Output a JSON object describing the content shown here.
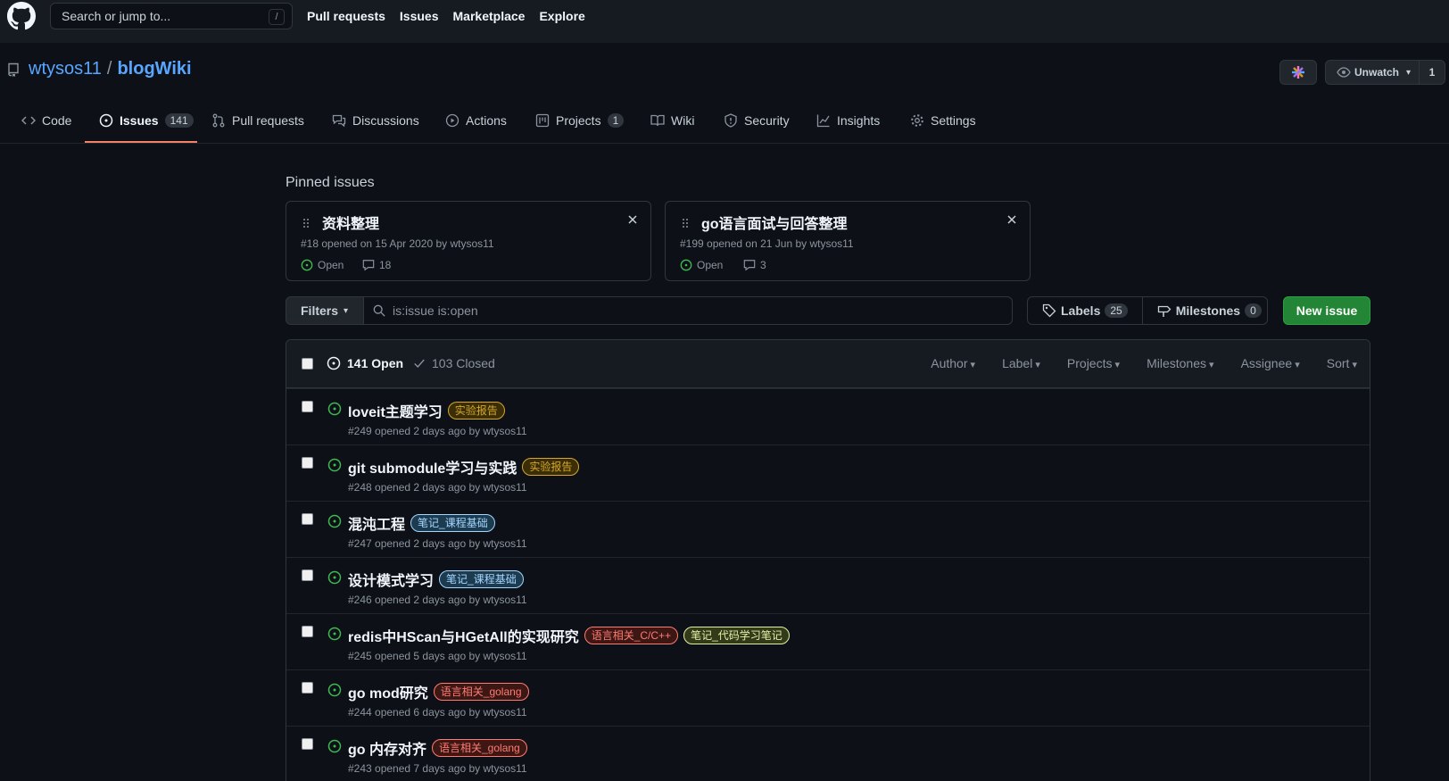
{
  "header": {
    "search_placeholder": "Search or jump to...",
    "search_shortcut": "/",
    "nav": [
      "Pull requests",
      "Issues",
      "Marketplace",
      "Explore"
    ]
  },
  "repo": {
    "owner": "wtysos11",
    "separator": "/",
    "name": "blogWiki",
    "watch_label": "Unwatch",
    "watch_count": "1"
  },
  "tabs": [
    {
      "label": "Code",
      "icon": "code-icon"
    },
    {
      "label": "Issues",
      "count": "141",
      "icon": "issue-icon"
    },
    {
      "label": "Pull requests",
      "icon": "pull-request-icon"
    },
    {
      "label": "Discussions",
      "icon": "discussions-icon"
    },
    {
      "label": "Actions",
      "icon": "play-icon"
    },
    {
      "label": "Projects",
      "count": "1",
      "icon": "project-icon"
    },
    {
      "label": "Wiki",
      "icon": "book-icon"
    },
    {
      "label": "Security",
      "icon": "shield-icon"
    },
    {
      "label": "Insights",
      "icon": "graph-icon"
    },
    {
      "label": "Settings",
      "icon": "gear-icon"
    }
  ],
  "pinned": {
    "title": "Pinned issues",
    "cards": [
      {
        "title": "资料整理",
        "meta": "#18 opened on 15 Apr 2020 by wtysos11",
        "state": "Open",
        "comments": "18"
      },
      {
        "title": "go语言面试与回答整理",
        "meta": "#199 opened on 21 Jun by wtysos11",
        "state": "Open",
        "comments": "3"
      }
    ]
  },
  "filter_bar": {
    "filters_label": "Filters",
    "query": "is:issue is:open",
    "labels_label": "Labels",
    "labels_count": "25",
    "milestones_label": "Milestones",
    "milestones_count": "0",
    "new_issue_label": "New issue"
  },
  "issue_list": {
    "open_label": "141 Open",
    "closed_label": "103 Closed",
    "sort_menus": [
      "Author",
      "Label",
      "Projects",
      "Milestones",
      "Assignee",
      "Sort"
    ],
    "issues": [
      {
        "title": "loveit主题学习",
        "meta": "#249 opened 2 days ago by wtysos11",
        "labels": [
          {
            "text": "实验报告",
            "color": "#d4a72c",
            "bg": "#3b2e06"
          }
        ]
      },
      {
        "title": "git submodule学习与实践",
        "meta": "#248 opened 2 days ago by wtysos11",
        "labels": [
          {
            "text": "实验报告",
            "color": "#d4a72c",
            "bg": "#3b2e06"
          }
        ]
      },
      {
        "title": "混沌工程",
        "meta": "#247 opened 2 days ago by wtysos11",
        "labels": [
          {
            "text": "笔记_课程基础",
            "color": "#a5d6ff",
            "bg": "#1c3b4f"
          }
        ]
      },
      {
        "title": "设计模式学习",
        "meta": "#246 opened 2 days ago by wtysos11",
        "labels": [
          {
            "text": "笔记_课程基础",
            "color": "#a5d6ff",
            "bg": "#1c3b4f"
          }
        ]
      },
      {
        "title": "redis中HScan与HGetAll的实现研究",
        "meta": "#245 opened 5 days ago by wtysos11",
        "labels": [
          {
            "text": "语言相关_C/C++",
            "color": "#ff7b72",
            "bg": "#3d1714"
          },
          {
            "text": "笔记_代码学习笔记",
            "color": "#e3f0a4",
            "bg": "#333a1a"
          }
        ]
      },
      {
        "title": "go mod研究",
        "meta": "#244 opened 6 days ago by wtysos11",
        "labels": [
          {
            "text": "语言相关_golang",
            "color": "#ff7b72",
            "bg": "#3d1714"
          }
        ]
      },
      {
        "title": "go 内存对齐",
        "meta": "#243 opened 7 days ago by wtysos11",
        "labels": [
          {
            "text": "语言相关_golang",
            "color": "#ff7b72",
            "bg": "#3d1714"
          }
        ]
      }
    ]
  },
  "colors": {
    "open_green": "#3fb950",
    "link_blue": "#58a6ff",
    "accent_underline": "#f78166",
    "primary_button": "#238636"
  }
}
